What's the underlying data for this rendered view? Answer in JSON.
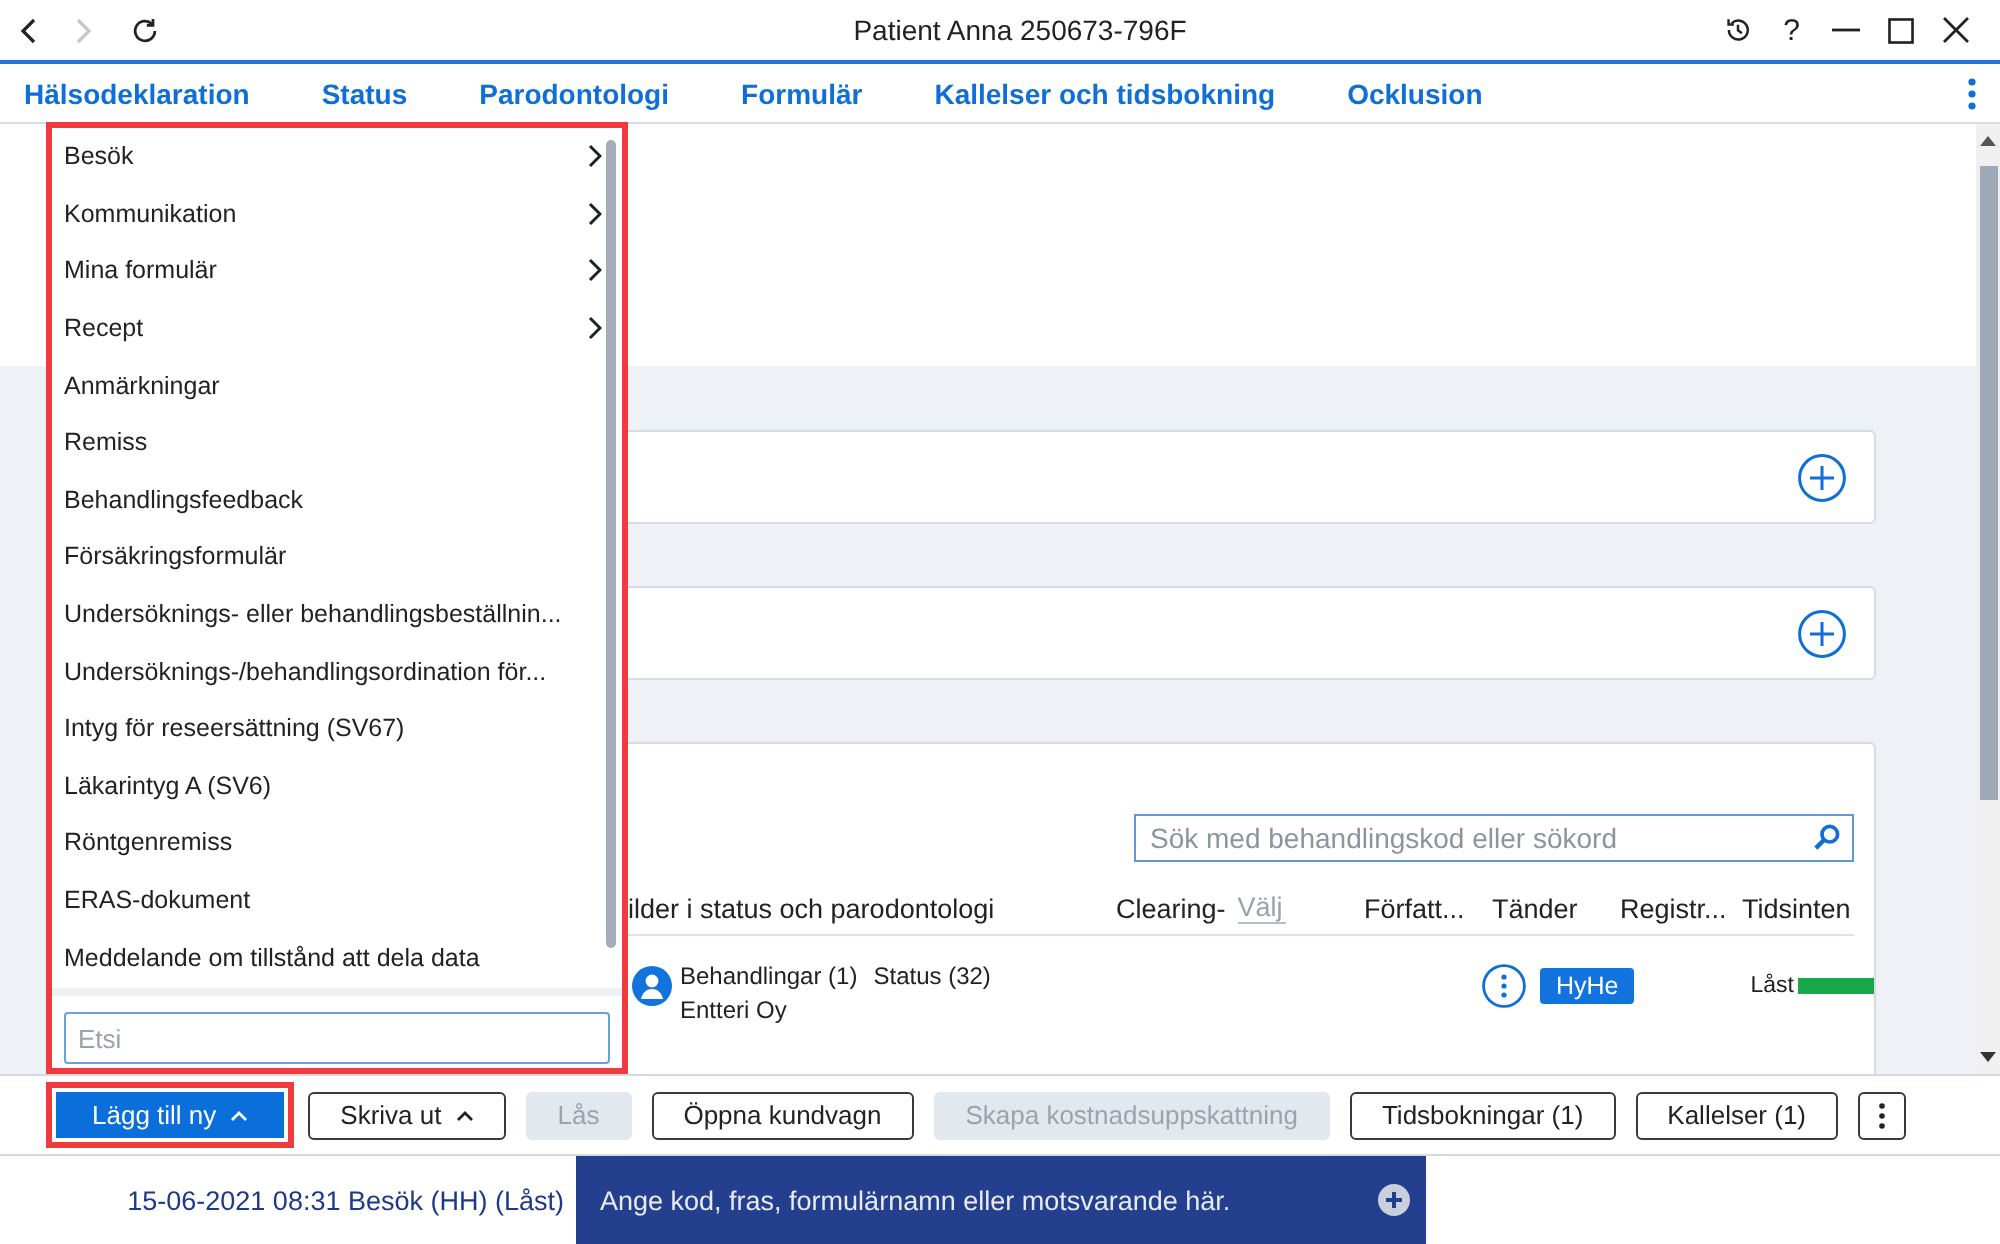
{
  "window": {
    "title": "Patient Anna 250673-796F",
    "help": "?",
    "nav": {
      "back_disabled": false,
      "forward_disabled": true
    }
  },
  "tabs": [
    {
      "label": "Hälsodeklaration"
    },
    {
      "label": "Status"
    },
    {
      "label": "Parodontologi"
    },
    {
      "label": "Formulär"
    },
    {
      "label": "Kallelser och tidsbokning"
    },
    {
      "label": "Ocklusion"
    }
  ],
  "menu": {
    "highlighted": true,
    "items": [
      {
        "label": "Besök",
        "submenu": true
      },
      {
        "label": "Kommunikation",
        "submenu": true
      },
      {
        "label": "Mina formulär",
        "submenu": true
      },
      {
        "label": "Recept",
        "submenu": true
      },
      {
        "label": "Anmärkningar",
        "submenu": false
      },
      {
        "label": "Remiss",
        "submenu": false
      },
      {
        "label": "Behandlingsfeedback",
        "submenu": false
      },
      {
        "label": "Försäkringsformulär",
        "submenu": false
      },
      {
        "label": "Undersöknings- eller behandlingsbeställnin...",
        "submenu": false
      },
      {
        "label": "Undersöknings-/behandlingsordination för...",
        "submenu": false
      },
      {
        "label": "Intyg för reseersättning (SV67)",
        "submenu": false
      },
      {
        "label": "Läkarintyg A (SV6)",
        "submenu": false
      },
      {
        "label": "Röntgenremiss",
        "submenu": false
      },
      {
        "label": "ERAS-dokument",
        "submenu": false
      },
      {
        "label": "Meddelande om tillstånd att dela data",
        "submenu": false
      }
    ],
    "search": {
      "placeholder": "Etsi"
    }
  },
  "treatments": {
    "search": {
      "placeholder": "Sök med behandlingskod eller sökord"
    },
    "columns": [
      {
        "label": "ilder i status och parodontologi"
      },
      {
        "label": "Clearing-",
        "filter_placeholder": "Välj"
      },
      {
        "label": "Författ..."
      },
      {
        "label": "Tänder"
      },
      {
        "label": "Registr..."
      },
      {
        "label": "Tidsinten"
      }
    ],
    "rows": [
      {
        "entries": [
          "Behandlingar (1)",
          "Status (32)"
        ],
        "company": "Entteri Oy",
        "initials": "HyHe",
        "status": "Låst",
        "color": "#17a84b"
      }
    ]
  },
  "toolbar": {
    "buttons": [
      {
        "label": "Lägg till ny",
        "kind": "primary",
        "caret": true,
        "disabled": false,
        "highlighted": true
      },
      {
        "label": "Skriva ut",
        "kind": "outline",
        "caret": true,
        "disabled": false,
        "highlighted": false
      },
      {
        "label": "Lås",
        "kind": "outline",
        "caret": false,
        "disabled": true,
        "highlighted": false
      },
      {
        "label": "Öppna kundvagn",
        "kind": "outline",
        "caret": false,
        "disabled": false,
        "highlighted": false
      },
      {
        "label": "Skapa kostnadsuppskattning",
        "kind": "outline",
        "caret": false,
        "disabled": true,
        "highlighted": false
      },
      {
        "label": "Tidsbokningar (1)",
        "kind": "outline",
        "caret": false,
        "disabled": false,
        "highlighted": false
      },
      {
        "label": "Kallelser (1)",
        "kind": "outline",
        "caret": false,
        "disabled": false,
        "highlighted": false
      }
    ]
  },
  "status_bar": {
    "visit": "15-06-2021 08:31 Besök (HH) (Låst)",
    "entry": {
      "placeholder": "Ange kod, fras, formulärnamn eller motsvarande här."
    }
  }
}
